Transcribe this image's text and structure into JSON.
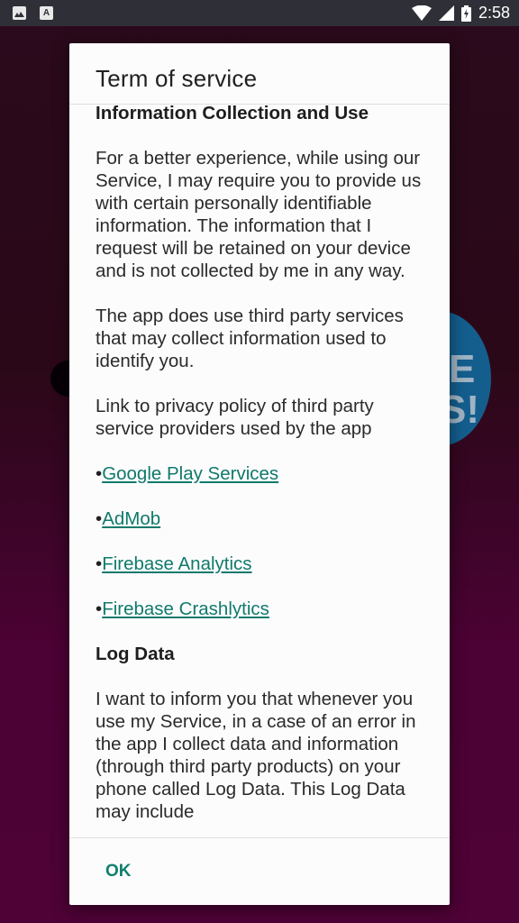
{
  "status_bar": {
    "left_icons": [
      "image-notification-icon",
      "text-notification-icon"
    ],
    "right_icons": [
      "wifi-icon",
      "signal-icon",
      "battery-charging-icon"
    ],
    "time": "2:58"
  },
  "background": {
    "badge_text_1": "E",
    "badge_text_2": "S!"
  },
  "dialog": {
    "title": "Term of service",
    "sections": {
      "info_heading": "Information Collection and Use",
      "info_para_1": "For a better experience, while using our Service, I may require you to provide us with certain personally identifiable information. The information that I request will be retained on your device and is not collected by me in any way.",
      "info_para_2": "The app does use third party services that may collect information used to identify you.",
      "info_para_3": "Link to privacy policy of third party service providers used by the app",
      "links": [
        {
          "bullet": "•",
          "label": "Google Play Services"
        },
        {
          "bullet": "•",
          "label": "AdMob"
        },
        {
          "bullet": "•",
          "label": "Firebase Analytics"
        },
        {
          "bullet": "•",
          "label": "Firebase Crashlytics"
        }
      ],
      "log_heading": "Log Data",
      "log_para": "I want to inform you that whenever you use my Service, in a case of an error in the app I collect data and information (through third party products) on your phone called Log Data. This Log Data may include"
    },
    "ok_label": "OK"
  },
  "colors": {
    "link": "#0f7a6b",
    "button": "#0f7f6e",
    "status_bar": "#2f2f37"
  }
}
